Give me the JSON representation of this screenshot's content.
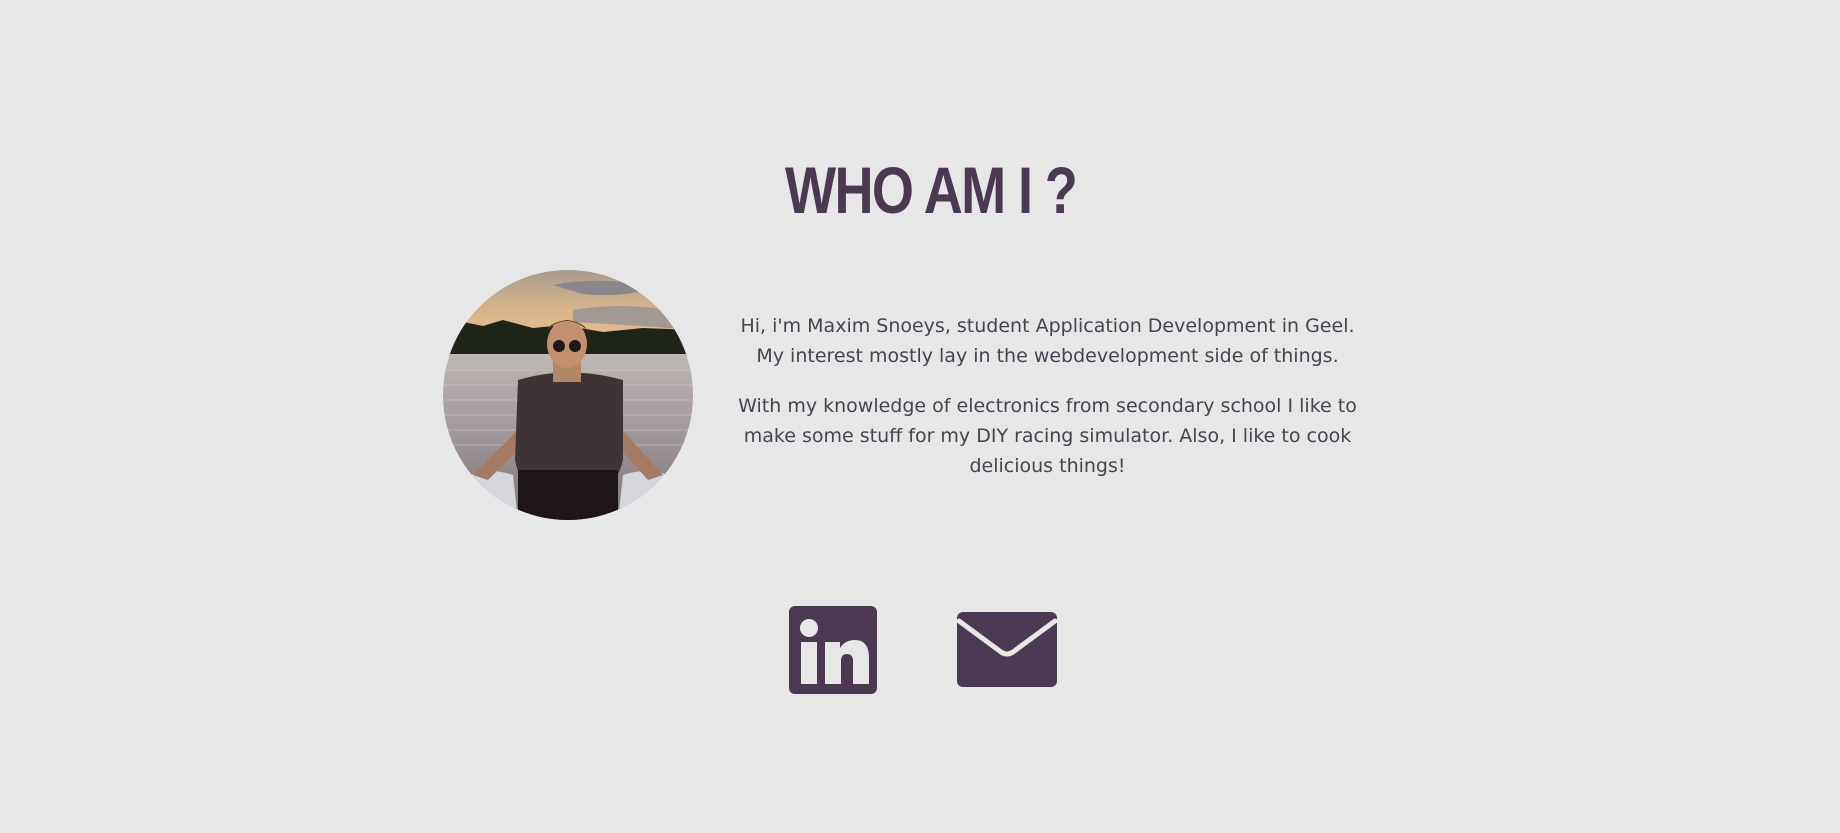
{
  "about": {
    "title": "WHO AM I ?",
    "paragraphs": [
      "Hi, i'm Maxim Snoeys, student Application Development in Geel. My interest mostly lay in the webdevelopment side of things.",
      "With my knowledge of electronics from secondary school I like to make some stuff for my DIY racing simulator. Also, I like to cook delicious things!"
    ]
  },
  "social": {
    "linkedin_icon": "linkedin-icon",
    "mail_icon": "envelope-icon"
  },
  "colors": {
    "background": "#e7e7e7",
    "accent": "#4a3950",
    "text": "#4a4150"
  }
}
